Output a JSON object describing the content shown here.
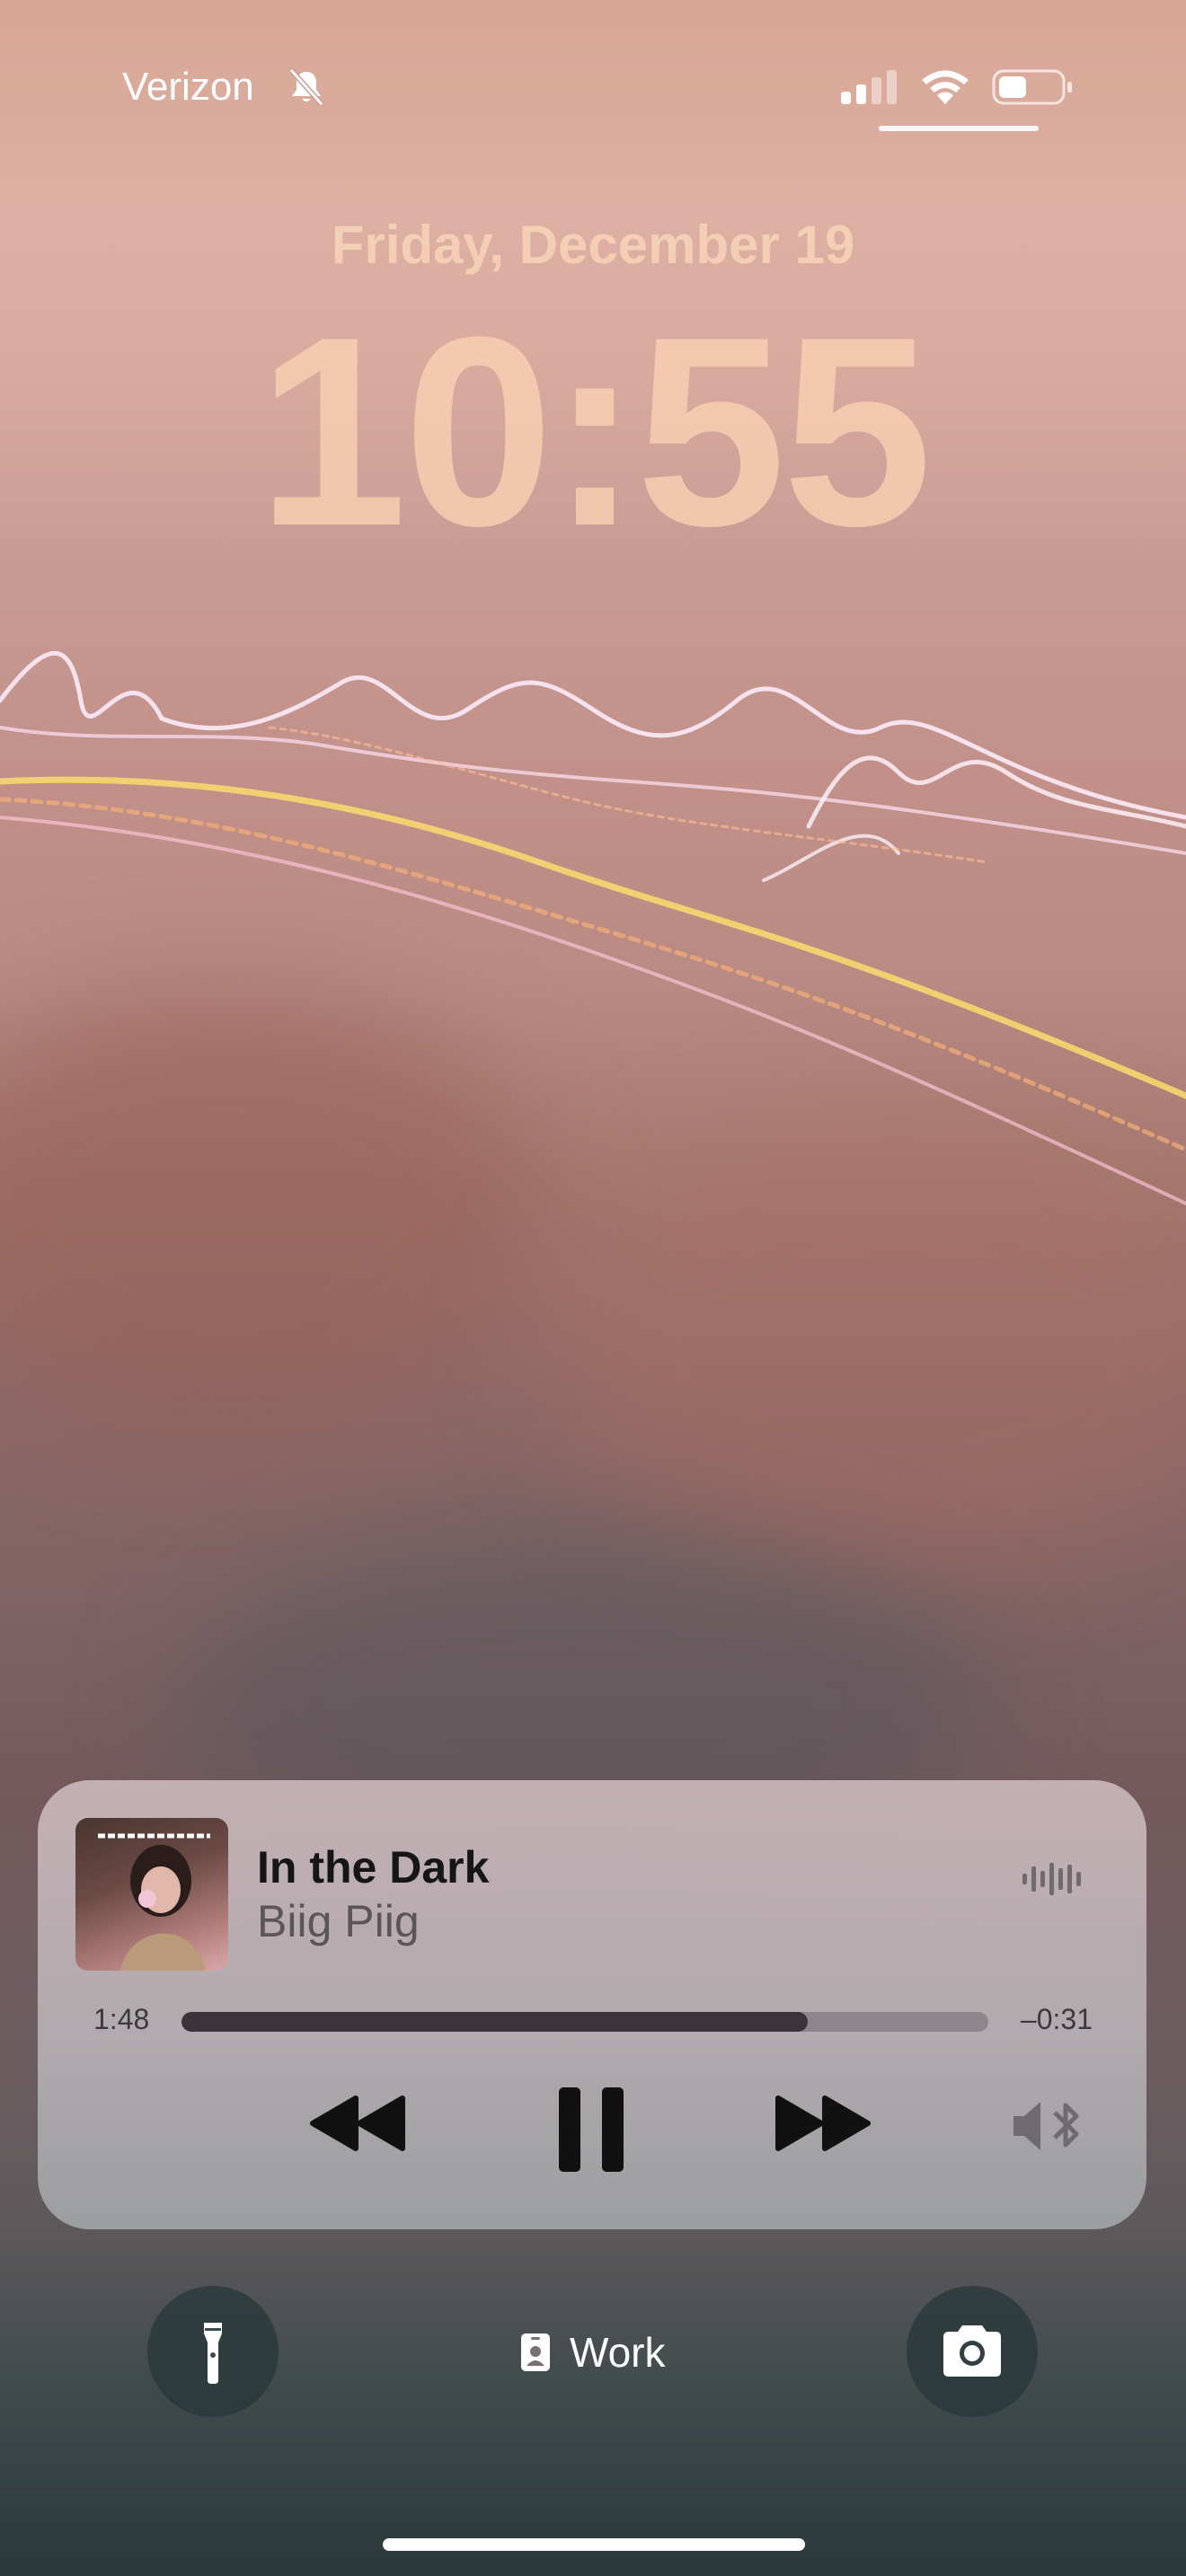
{
  "status_bar": {
    "carrier": "Verizon",
    "mute_icon": "bell-slash-icon",
    "signal_icon": "cellular-signal-icon",
    "wifi_icon": "wifi-icon",
    "battery_icon": "battery-icon"
  },
  "lock_screen": {
    "date": "Friday, December 19",
    "time": "10:55"
  },
  "now_playing": {
    "title": "In the Dark",
    "artist": "Biig Piig",
    "elapsed": "1:48",
    "remaining": "–0:31",
    "progress": 0.776,
    "controls": [
      "rewind-icon",
      "pause-icon",
      "fast-forward-icon",
      "speaker-bluetooth-icon"
    ],
    "waveform_icon": "waveform-icon"
  },
  "bottom": {
    "focus_label": "Work",
    "focus_icon": "id-badge-icon",
    "left_button": "flashlight-icon",
    "right_button": "camera-icon"
  },
  "colors": {
    "accent_text": "#161616",
    "clock": "#fad2b4",
    "player_bg": "#bfb3b6"
  }
}
